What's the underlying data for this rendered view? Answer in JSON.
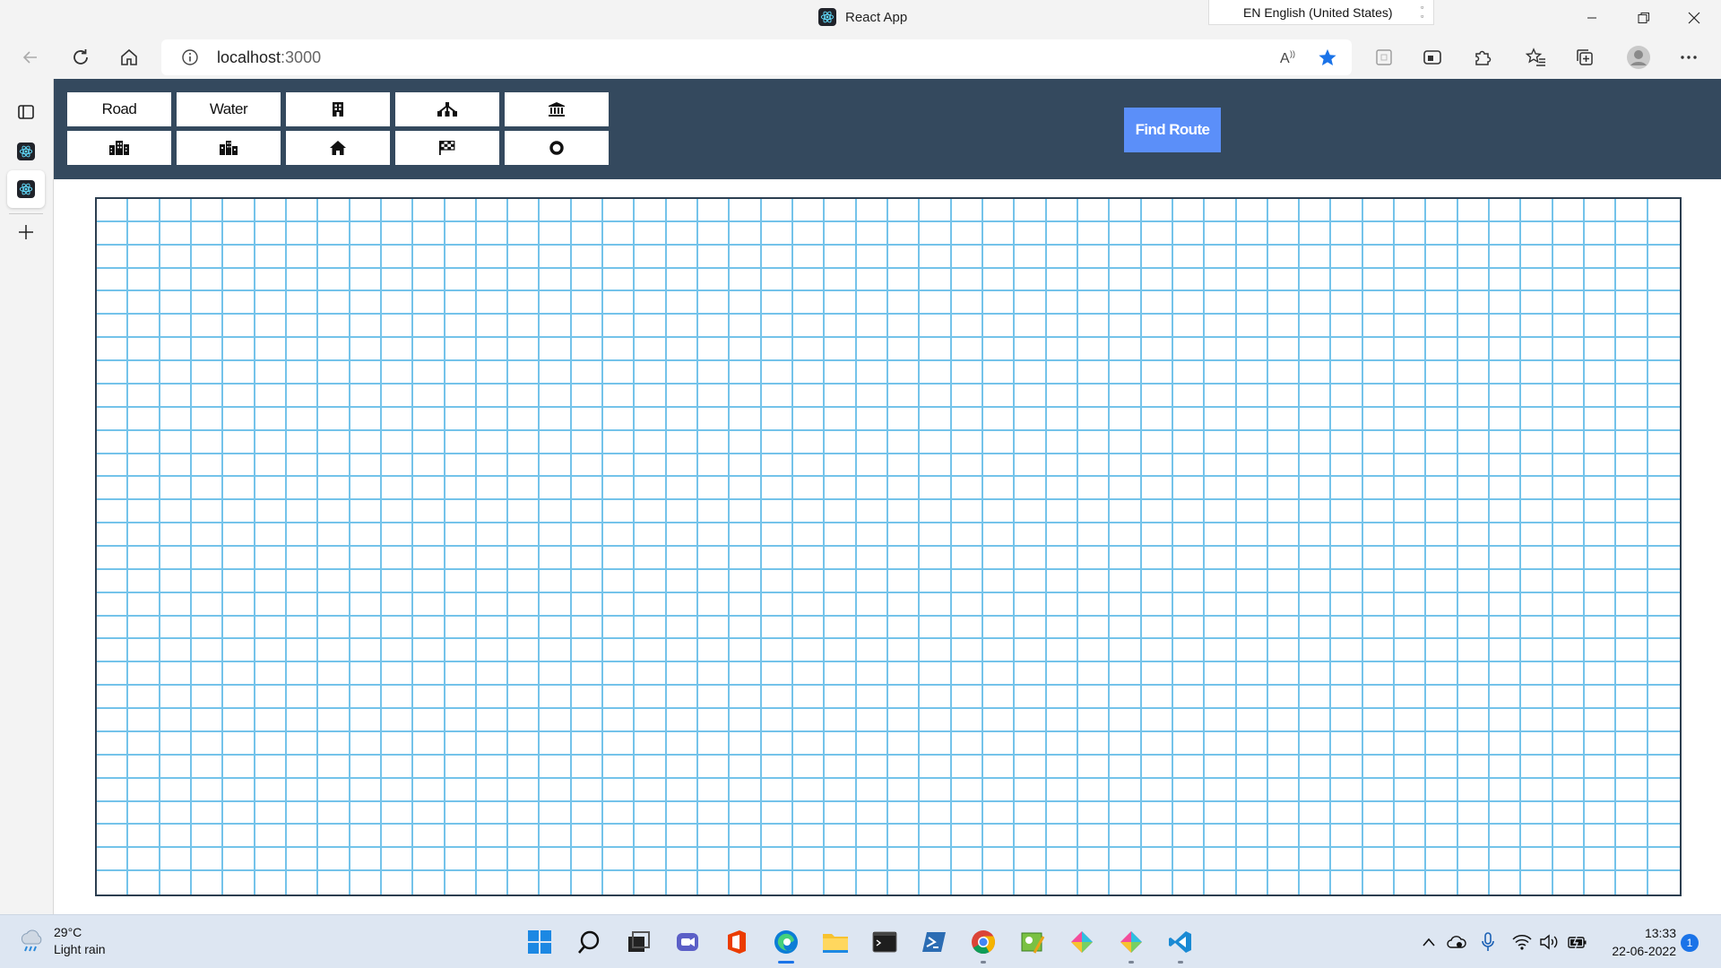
{
  "window": {
    "title": "React App",
    "language_indicator": "EN English (United States)"
  },
  "address_bar": {
    "url_host": "localhost",
    "url_port": ":3000"
  },
  "toolbar": {
    "tools_row1": [
      {
        "label": "Road",
        "icon": ""
      },
      {
        "label": "Water",
        "icon": ""
      },
      {
        "label": "",
        "icon": "building-icon"
      },
      {
        "label": "",
        "icon": "tower-icon"
      },
      {
        "label": "",
        "icon": "museum-icon"
      }
    ],
    "tools_row2": [
      {
        "label": "",
        "icon": "city-icon"
      },
      {
        "label": "",
        "icon": "industry-icon"
      },
      {
        "label": "",
        "icon": "home-icon"
      },
      {
        "label": "",
        "icon": "finish-flag-icon"
      },
      {
        "label": "",
        "icon": "target-icon"
      }
    ],
    "find_route_label": "Find Route"
  },
  "grid": {
    "columns": 50,
    "rows": 30,
    "line_color": "#74c3ea",
    "border_color": "#2c3e50"
  },
  "colors": {
    "toolbar_bg": "#34495e",
    "find_route_bg": "#5b8ff9"
  },
  "taskbar": {
    "temperature": "29°C",
    "weather": "Light rain",
    "time": "13:33",
    "date": "22-06-2022",
    "notification_count": "1"
  }
}
